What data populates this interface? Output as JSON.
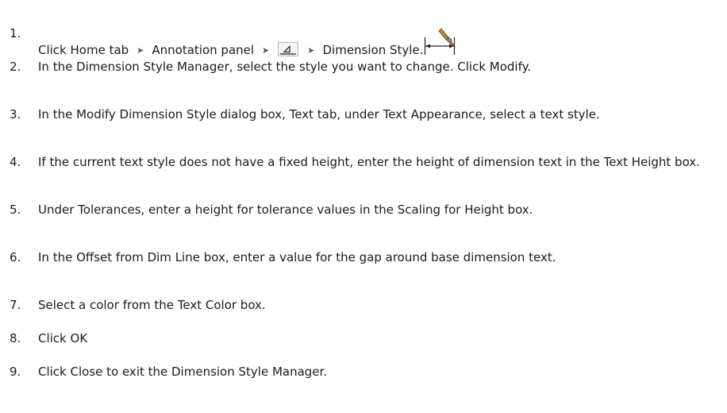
{
  "steps": [
    {
      "num": "1.",
      "parts": {
        "home": "Click Home tab",
        "arrow": "➤",
        "panel": "Annotation panel",
        "dimstyle": "Dimension Style."
      },
      "icons": [
        "dimension-panel-launcher-icon",
        "dimension-style-icon"
      ]
    },
    {
      "num": "2.",
      "text": "In the Dimension Style Manager, select the style you want to change. Click Modify."
    },
    {
      "num": "3.",
      "text": "In the Modify Dimension Style dialog box, Text tab, under Text Appearance, select a text style."
    },
    {
      "num": "4.",
      "text": "If the current text style does not have a fixed height, enter the height of dimension text in the Text Height box."
    },
    {
      "num": "5.",
      "text": "Under Tolerances, enter a height for tolerance values in the Scaling for Height box."
    },
    {
      "num": "6.",
      "text": "In the Offset from Dim Line box, enter a value for the gap around base dimension text."
    },
    {
      "num": "7.",
      "text": "Select a color from the Text Color box."
    },
    {
      "num": "8.",
      "text": "Click OK"
    },
    {
      "num": "9.",
      "text": "Click Close to exit the Dimension Style Manager."
    }
  ]
}
